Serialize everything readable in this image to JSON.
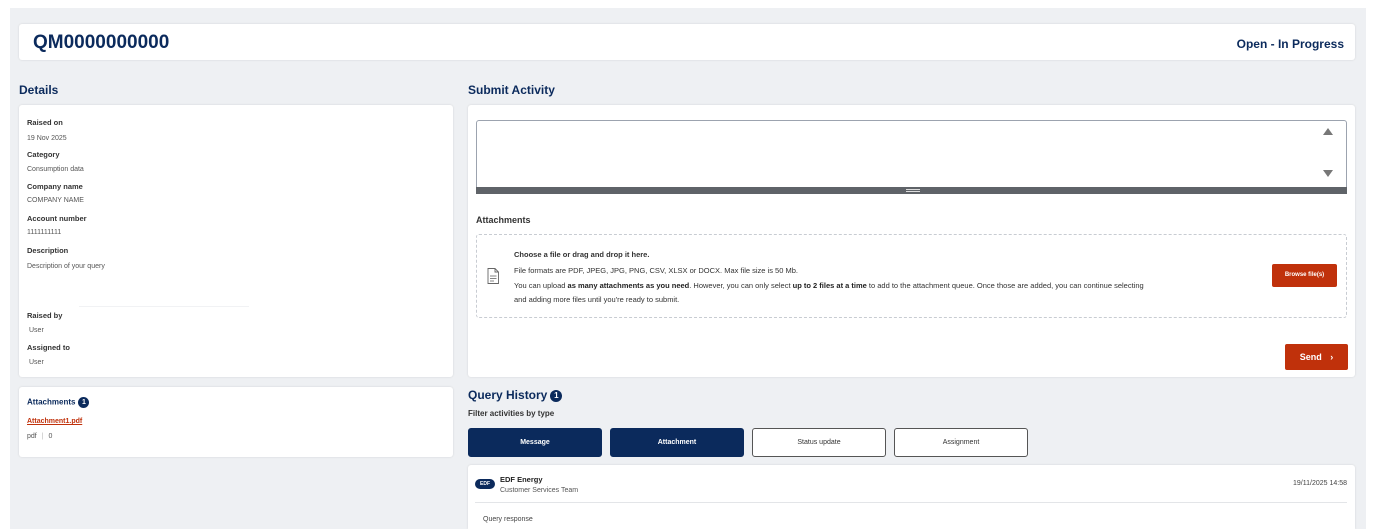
{
  "header": {
    "reference": "QM0000000000",
    "status": "Open - In Progress"
  },
  "details": {
    "title": "Details",
    "raised_on_label": "Raised on",
    "raised_on_value": "19 Nov 2025",
    "category_label": "Category",
    "category_value": "Consumption data",
    "company_label": "Company name",
    "company_value": "COMPANY NAME",
    "account_label": "Account number",
    "account_value": "1111111111",
    "description_label": "Description",
    "description_value": "Description of your query",
    "raised_by_label": "Raised by",
    "raised_by_value": "User",
    "assigned_to_label": "Assigned to",
    "assigned_to_value": "User"
  },
  "attachments_panel": {
    "title": "Attachments",
    "count": "1",
    "file_name": "Attachment1.pdf",
    "file_type": "pdf",
    "file_size": "0"
  },
  "submit_activity": {
    "title": "Submit Activity",
    "message_value": "",
    "attachments_label": "Attachments",
    "dropzone_title": "Choose a file or drag and drop it here.",
    "dropzone_formats": "File formats are PDF, JPEG, JPG, PNG, CSV, XLSX or DOCX. Max file size is 50 Mb.",
    "dropzone_text_1": "You can upload ",
    "dropzone_bold_1": "as many attachments as you need",
    "dropzone_text_2": ". However, you can only select ",
    "dropzone_bold_2": "up to 2 files at a time",
    "dropzone_text_3": " to add to the attachment queue. Once those are added, you can continue selecting",
    "dropzone_text_4": "and adding more files until you're ready to submit.",
    "browse_label": "Browse file(s)",
    "send_label": "Send",
    "send_chevron": "›"
  },
  "query_history": {
    "title": "Query History",
    "count": "1",
    "filter_label": "Filter activities by type",
    "filters": [
      {
        "label": "Message",
        "active": true
      },
      {
        "label": "Attachment",
        "active": true
      },
      {
        "label": "Status update",
        "active": false
      },
      {
        "label": "Assignment",
        "active": false
      }
    ],
    "entries": [
      {
        "avatar": "EDF",
        "sender": "EDF Energy",
        "team": "Customer Services Team",
        "timestamp": "19/11/2025 14:58",
        "body": "Query response"
      }
    ]
  },
  "colors": {
    "brand_navy": "#0b2a5c",
    "accent_red": "#c0310b",
    "page_background": "#eef0f3"
  }
}
